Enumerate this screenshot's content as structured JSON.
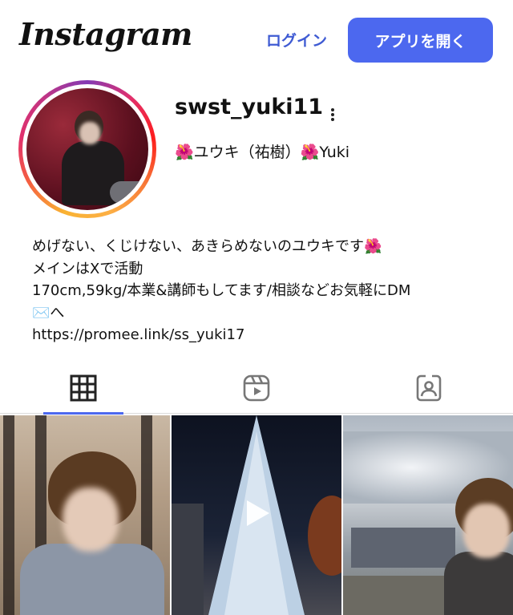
{
  "header": {
    "logo_text": "Instagram",
    "login_label": "ログイン",
    "open_app_label": "アプリを開く"
  },
  "profile": {
    "username": "swst_yuki11",
    "full_name": "🌺ユウキ（祐樹）🌺Yuki",
    "bio_lines": [
      "めげない、くじけない、あきらめないのユウキです🌺",
      "メインはXで活動",
      "170cm,59kg/本業&講師もしてます/相談などお気軽にDM",
      "✉️へ"
    ],
    "link": "https://promee.link/ss_yuki17"
  },
  "tabs": [
    {
      "icon": "grid-icon",
      "active": true
    },
    {
      "icon": "reels-icon",
      "active": false
    },
    {
      "icon": "tagged-icon",
      "active": false
    }
  ],
  "posts": [
    {
      "type": "photo"
    },
    {
      "type": "video",
      "icon": "play-icon"
    },
    {
      "type": "photo"
    }
  ],
  "colors": {
    "accent": "#4c68ef",
    "link_blue": "#3f5bd3"
  }
}
